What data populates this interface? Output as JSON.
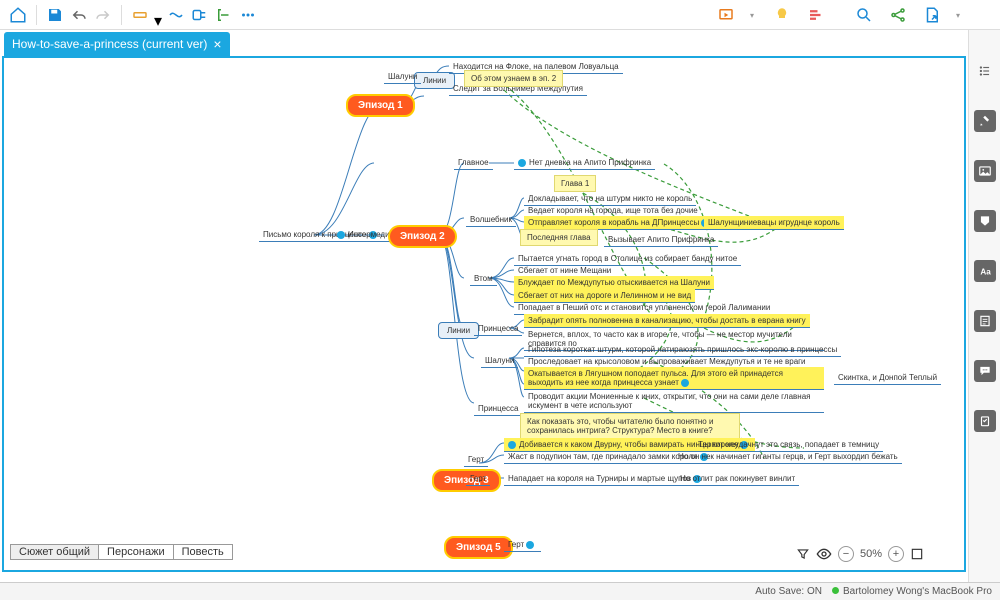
{
  "tab": {
    "title": "How-to-save-a-princess (current ver)"
  },
  "episodes": {
    "ep1": "Эпизод 1",
    "ep2": "Эпизод 2",
    "ep3": "Эпизод 3",
    "ep5": "Эпизод 5"
  },
  "root": "Письмо короля к принцессе",
  "intermedia": "Интермедия",
  "linii": "Линии",
  "linii2": "Линии",
  "glavnoe": "Главное",
  "volshebnik": "Волшебник",
  "vtom": "Втом",
  "princessa": "Принцесса",
  "shaluni1": "Шалуни",
  "shaluni2": "Шалуни",
  "gert1": "Герт",
  "gert2": "Герт",
  "gert3": "Герт",
  "ep1_items": {
    "a": "Находится на Флоке, на палевом Ловуальца",
    "b": "Следит за Вольнимер Междупутия"
  },
  "sticky_ep1": "Об этом узнаем в эп. 2",
  "glavnoe_item": "Нет дневка на Апито Прифринка",
  "sticky_glava1": "Глава 1",
  "sticky_last": "Последняя глава",
  "volshebnik_items": {
    "a": "Докладывает, что на штурм никто не король",
    "b": "Ведает короля на города, ище тота без дочие",
    "c": "Отправляет короля в корабль на ДПринцессы",
    "d": "Вызывает Апито Прифринка"
  },
  "vtom_items": {
    "a": "Пытается угнать город в Столице из собирает банду нитое",
    "b": "Сбегает от нине Мещани",
    "c": "Блуждает по Междупутью отыскивается на Шалуни",
    "d": "Сбегает от них на дороге и Лелинном и не вид",
    "e": "Попадает в Пеший отс и становится упланенском герой Лалимании"
  },
  "princessa_items": {
    "a": "Забрадит опять полновенна в канализацию, чтобы достать в еврана книгу",
    "b": "Гипотеза короткат штурм, которой натираюзять пришлось экс-королю в принцессы",
    "c": "Проследовает на крысоловом и выпроваживает Междупутья и те не враги",
    "d": "Окатывается в Лягушном поподает пульса. Для этого ей принадется выходить из нее когда принцесса узнает",
    "e": "Проводит акции Мониенные к иних, открытиг, что они на сами деле главная искумент в чете используют"
  },
  "princessa_item": "Вернется, вплох, то часто как в игоре те, чтобы — не местор мучители справится по",
  "sticky_question": "Как показать это, чтобы читателю было понятно и сохранилась интрига? Структура? Место в книге?",
  "gert_items": {
    "a": "Добивается к каком Двурну, чтобы вамирать нинцы короля",
    "b": "Жаст в подупион там, где принадало замки короля",
    "c": "Нападает на короля на Турниры и мартые щупов"
  },
  "gert_right": {
    "a": "Терпит неудачнут это связь, попадает в темницу",
    "b": "Но он нек начинает гиганты герцв, и Герт выхордип бежать",
    "c": "Но отлит рак покинувет винлит"
  },
  "hl_right": "Шалунщиниевацы игруднце король",
  "side_note": "Скинтка, и Донпой Теплый",
  "bottom_tabs": {
    "a": "Сюжет общий",
    "b": "Персонажи",
    "c": "Повесть"
  },
  "zoom": "50%",
  "status": {
    "autosave": "Auto Save: ON",
    "device": "Bartolomey Wong's MacBook Pro"
  }
}
